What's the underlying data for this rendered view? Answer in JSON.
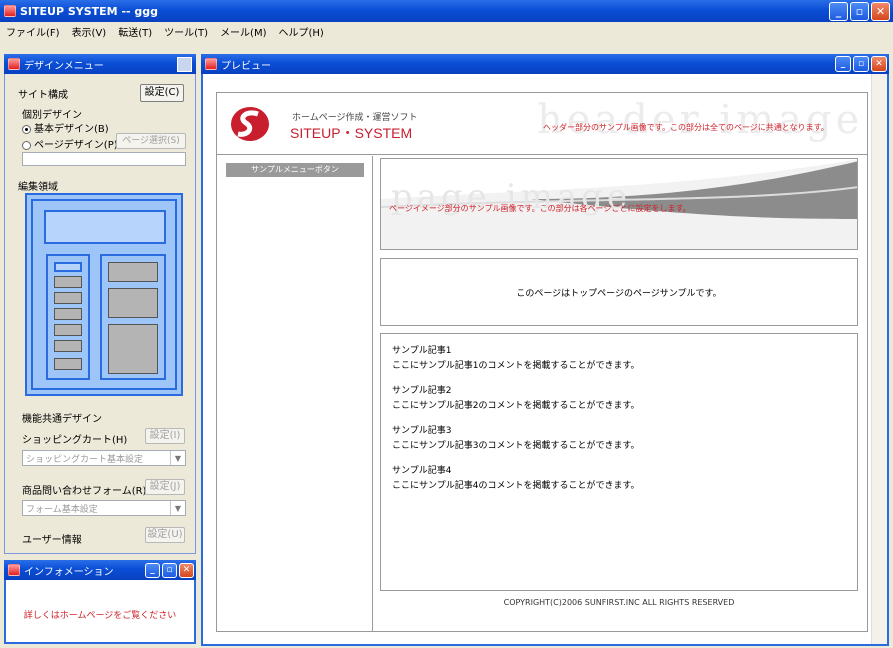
{
  "app": {
    "title": "SITEUP SYSTEM -- ggg",
    "menu": [
      "ファイル(F)",
      "表示(V)",
      "転送(T)",
      "ツール(T)",
      "メール(M)",
      "ヘルプ(H)"
    ]
  },
  "design_menu": {
    "title": "デザインメニュー",
    "site_structure_label": "サイト構成",
    "settings_button": "設定(C)",
    "individual_design_label": "個別デザイン",
    "basic_design_radio": "基本デザイン(B)",
    "page_design_radio": "ページデザイン(P)",
    "page_design_button": "ページ選択(S)",
    "edit_area_label": "編集領域",
    "shop_common_label": "機能共通デザイン",
    "shopping_cart_label": "ショッピングカート(H)",
    "shopping_cart_button": "設定(I)",
    "shopping_cart_combo": "ショッピングカート基本設定",
    "inquiry_form_label": "商品問い合わせフォーム(R)",
    "inquiry_form_button": "設定(J)",
    "inquiry_form_combo": "フォーム基本設定",
    "user_info_label": "ユーザー情報",
    "user_info_button": "設定(U)"
  },
  "info_panel": {
    "title": "インフォメーション",
    "message": "詳しくはホームページをご覧ください"
  },
  "preview": {
    "title": "プレビュー",
    "header": {
      "tagline": "ホームページ作成・運営ソフト",
      "logo_text": "SITEUP・SYSTEM",
      "watermark": "header image",
      "sample_note": "ヘッダー部分のサンプル画像です。この部分は全てのページに共通となります。"
    },
    "sidebar_button": "サンプルメニューボタン",
    "page_image": {
      "watermark": "page image",
      "note": "ページイメージ部分のサンプル画像です。この部分は各ページごとに設定をします。"
    },
    "top_message": "このページはトップページのページサンプルです。",
    "articles": [
      {
        "title": "サンプル記事1",
        "body": "ここにサンプル記事1のコメントを掲載することができます。"
      },
      {
        "title": "サンプル記事2",
        "body": "ここにサンプル記事2のコメントを掲載することができます。"
      },
      {
        "title": "サンプル記事3",
        "body": "ここにサンプル記事3のコメントを掲載することができます。"
      },
      {
        "title": "サンプル記事4",
        "body": "ここにサンプル記事4のコメントを掲載することができます。"
      }
    ],
    "copyright": "COPYRIGHT(C)2006 SUNFIRST.INC ALL RIGHTS RESERVED"
  },
  "colors": {
    "titlebar": "#0a4ed6",
    "panel_blue": "#9ec5f8",
    "accent_red": "#d0202a",
    "logo_red": "#c81e2e"
  }
}
